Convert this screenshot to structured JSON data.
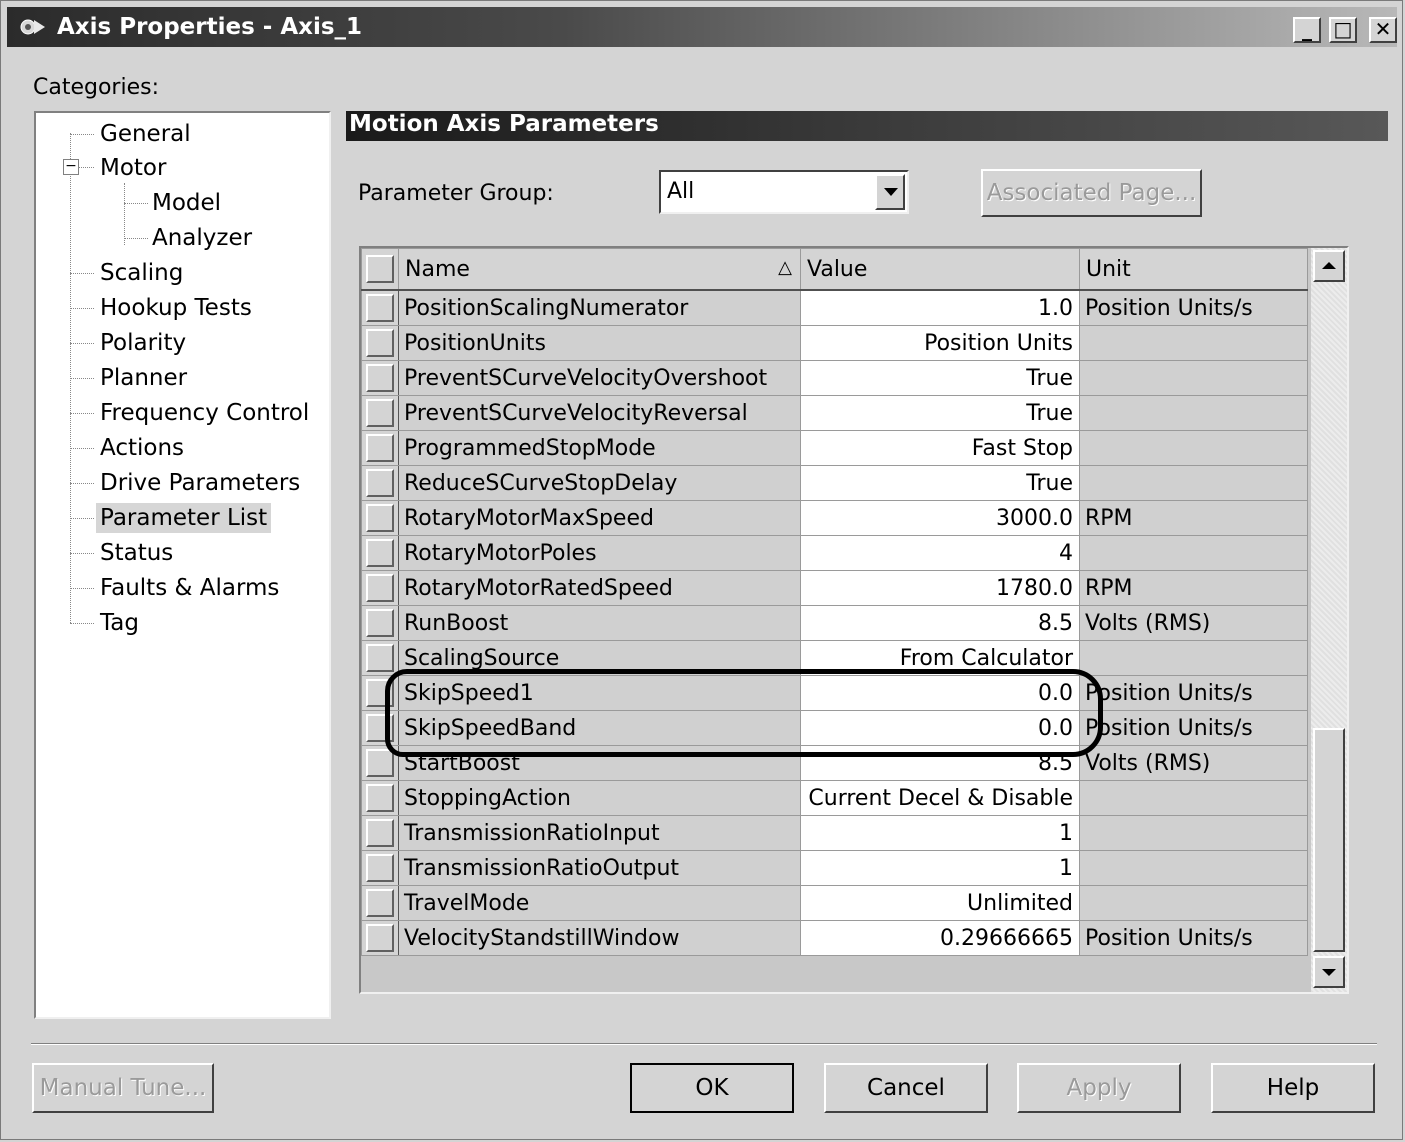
{
  "window": {
    "title": "Axis Properties - Axis_1",
    "controls": {
      "minimize": "_",
      "maximize": "□",
      "close": "✕"
    }
  },
  "categories_label": "Categories:",
  "tree": [
    {
      "label": "General"
    },
    {
      "label": "Motor"
    },
    {
      "label": "Model"
    },
    {
      "label": "Analyzer"
    },
    {
      "label": "Scaling"
    },
    {
      "label": "Hookup Tests"
    },
    {
      "label": "Polarity"
    },
    {
      "label": "Planner"
    },
    {
      "label": "Frequency Control"
    },
    {
      "label": "Actions"
    },
    {
      "label": "Drive Parameters"
    },
    {
      "label": "Parameter List"
    },
    {
      "label": "Status"
    },
    {
      "label": "Faults & Alarms"
    },
    {
      "label": "Tag"
    }
  ],
  "selected_category": "Parameter List",
  "section_title": "Motion Axis Parameters",
  "parameter_group": {
    "label": "Parameter Group:",
    "value": "All",
    "associated_page_label": "Associated Page..."
  },
  "grid": {
    "columns": {
      "name": "Name",
      "value": "Value",
      "unit": "Unit"
    },
    "sort_indicator": "△",
    "rows": [
      {
        "name": "PositionScalingNumerator",
        "value": "1.0",
        "unit": "Position Units/s"
      },
      {
        "name": "PositionUnits",
        "value": "Position Units",
        "unit": ""
      },
      {
        "name": "PreventSCurveVelocityOvershoot",
        "value": "True",
        "unit": ""
      },
      {
        "name": "PreventSCurveVelocityReversal",
        "value": "True",
        "unit": ""
      },
      {
        "name": "ProgrammedStopMode",
        "value": "Fast Stop",
        "unit": ""
      },
      {
        "name": "ReduceSCurveStopDelay",
        "value": "True",
        "unit": ""
      },
      {
        "name": "RotaryMotorMaxSpeed",
        "value": "3000.0",
        "unit": "RPM"
      },
      {
        "name": "RotaryMotorPoles",
        "value": "4",
        "unit": ""
      },
      {
        "name": "RotaryMotorRatedSpeed",
        "value": "1780.0",
        "unit": "RPM"
      },
      {
        "name": "RunBoost",
        "value": "8.5",
        "unit": "Volts (RMS)"
      },
      {
        "name": "ScalingSource",
        "value": "From Calculator",
        "unit": ""
      },
      {
        "name": "SkipSpeed1",
        "value": "0.0",
        "unit": "Position Units/s"
      },
      {
        "name": "SkipSpeedBand",
        "value": "0.0",
        "unit": "Position Units/s"
      },
      {
        "name": "StartBoost",
        "value": "8.5",
        "unit": "Volts (RMS)"
      },
      {
        "name": "StoppingAction",
        "value": "Current Decel & Disable",
        "unit": ""
      },
      {
        "name": "TransmissionRatioInput",
        "value": "1",
        "unit": ""
      },
      {
        "name": "TransmissionRatioOutput",
        "value": "1",
        "unit": ""
      },
      {
        "name": "TravelMode",
        "value": "Unlimited",
        "unit": ""
      },
      {
        "name": "VelocityStandstillWindow",
        "value": "0.29666665",
        "unit": "Position Units/s"
      }
    ]
  },
  "buttons": {
    "manual_tune": "Manual Tune...",
    "ok": "OK",
    "cancel": "Cancel",
    "apply": "Apply",
    "help": "Help"
  }
}
